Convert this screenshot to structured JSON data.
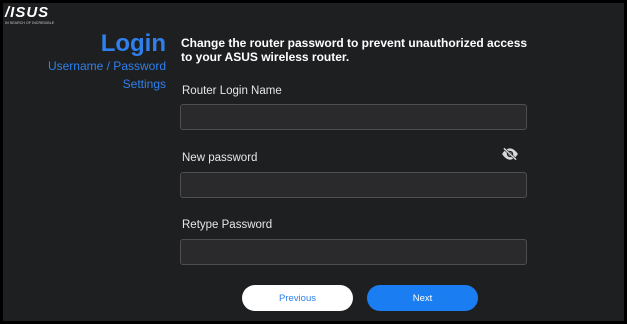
{
  "brand": {
    "logo_text": "/ISUS",
    "tagline": "IN SEARCH OF INCREDIBLE"
  },
  "sidebar": {
    "title": "Login",
    "items": [
      {
        "label": "Username / Password"
      },
      {
        "label": "Settings"
      }
    ]
  },
  "main": {
    "description": "Change the router password to prevent unauthorized access to your ASUS wireless router.",
    "fields": {
      "login_name": {
        "label": "Router Login Name",
        "value": ""
      },
      "new_password": {
        "label": "New password",
        "value": ""
      },
      "retype_password": {
        "label": "Retype Password",
        "value": ""
      }
    },
    "password_toggle_icon": "eye-slash-icon"
  },
  "buttons": {
    "previous": "Previous",
    "next": "Next"
  },
  "colors": {
    "accent": "#2f80ed",
    "primary_button": "#1a7ef2",
    "background": "#1e1f21"
  }
}
